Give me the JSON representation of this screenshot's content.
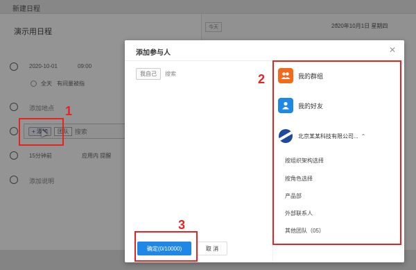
{
  "window": {
    "title": "新建日程"
  },
  "background": {
    "event_title": "演示用日程",
    "start_date": "2020-10-01",
    "start_time": "09:00",
    "all_day_label": "全天",
    "busy_label": "有间量被指",
    "location_placeholder": "添加地点",
    "participant_chip": "+ 添加",
    "participant_chip2": "团队",
    "participant_search": "搜索",
    "remind_value": "15分钟前",
    "remind_type": "应用内 提醒",
    "desc_placeholder": "添加说明",
    "right_nav_button": "今天",
    "right_date": "2020年10月1日 星期四"
  },
  "modal": {
    "title": "添加参与人",
    "close_icon": "close-icon",
    "selected_tag": "我自己",
    "search_placeholder": "搜索",
    "groups": [
      {
        "label": "我的群组",
        "icon": "group-icon",
        "color": "#f26b1d"
      },
      {
        "label": "我的好友",
        "icon": "person-icon",
        "color": "#1f87e5"
      }
    ],
    "organization": {
      "label": "北京某某科技有限公司...",
      "icon": "org-logo-icon",
      "color": "#1e4a9b"
    },
    "departments": [
      "按组织架构选择",
      "按角色选择",
      "产品部",
      "外部联系人",
      "其他团队（05）"
    ],
    "confirm_label": "确定(0/10000)",
    "cancel_label": "取 消"
  },
  "annotations": {
    "step1": "1",
    "step2": "2",
    "step3": "3",
    "color": "#e52323"
  }
}
